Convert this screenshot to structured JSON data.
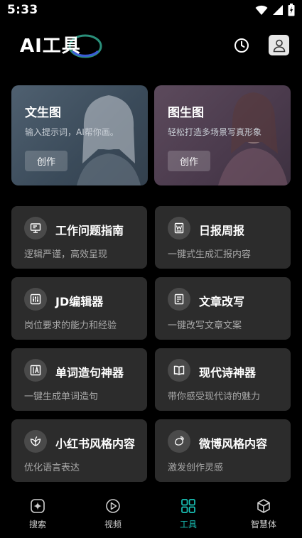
{
  "status_bar": {
    "time": "5:33"
  },
  "header": {
    "logo_text": "AI工具"
  },
  "hero_cards": [
    {
      "title": "文生图",
      "subtitle": "输入提示词，AI帮你画。",
      "button": "创作"
    },
    {
      "title": "图生图",
      "subtitle": "轻松打造多场景写真形象",
      "button": "创作"
    }
  ],
  "tools": [
    {
      "title": "工作问题指南",
      "desc": "逻辑严谨，高效呈现",
      "icon": "monitor-icon"
    },
    {
      "title": "日报周报",
      "desc": "一键式生成汇报内容",
      "icon": "document-w-icon"
    },
    {
      "title": "JD编辑器",
      "desc": "岗位要求的能力和经验",
      "icon": "sliders-icon"
    },
    {
      "title": "文章改写",
      "desc": "一键改写文章文案",
      "icon": "doc-edit-icon"
    },
    {
      "title": "单词造句神器",
      "desc": "一键生成单词造句",
      "icon": "letter-a-icon"
    },
    {
      "title": "现代诗神器",
      "desc": "带你感受现代诗的魅力",
      "icon": "book-icon"
    },
    {
      "title": "小红书风格内容",
      "desc": "优化语言表达",
      "icon": "leaf-icon"
    },
    {
      "title": "微博风格内容",
      "desc": "激发创作灵感",
      "icon": "weibo-icon"
    }
  ],
  "bottom_nav": [
    {
      "label": "搜索",
      "icon": "sparkle-icon",
      "active": false
    },
    {
      "label": "视频",
      "icon": "play-icon",
      "active": false
    },
    {
      "label": "工具",
      "icon": "grid-icon",
      "active": true
    },
    {
      "label": "智慧体",
      "icon": "cube-icon",
      "active": false
    }
  ],
  "colors": {
    "accent": "#19c3b8",
    "card_bg": "#2c2c2c",
    "background": "#000000"
  }
}
